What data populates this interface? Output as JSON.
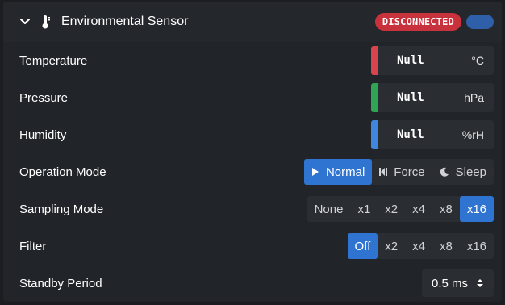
{
  "header": {
    "title": "Environmental Sensor",
    "status": "DISCONNECTED",
    "status_color": "#c8323c",
    "toggle_color": "#2e5fa8"
  },
  "readings": [
    {
      "label": "Temperature",
      "value": "Null",
      "unit": "°C",
      "color": "#d9434b"
    },
    {
      "label": "Pressure",
      "value": "Null",
      "unit": "hPa",
      "color": "#2fa553"
    },
    {
      "label": "Humidity",
      "value": "Null",
      "unit": "%rH",
      "color": "#3f86e0"
    }
  ],
  "operation_mode": {
    "label": "Operation Mode",
    "options": [
      "Normal",
      "Force",
      "Sleep"
    ],
    "selected": "Normal"
  },
  "sampling_mode": {
    "label": "Sampling Mode",
    "options": [
      "None",
      "x1",
      "x2",
      "x4",
      "x8",
      "x16"
    ],
    "selected": "x16"
  },
  "filter": {
    "label": "Filter",
    "options": [
      "Off",
      "x2",
      "x4",
      "x8",
      "x16"
    ],
    "selected": "Off"
  },
  "standby": {
    "label": "Standby Period",
    "value": "0.5 ms"
  },
  "accent_color": "#2f74d0"
}
